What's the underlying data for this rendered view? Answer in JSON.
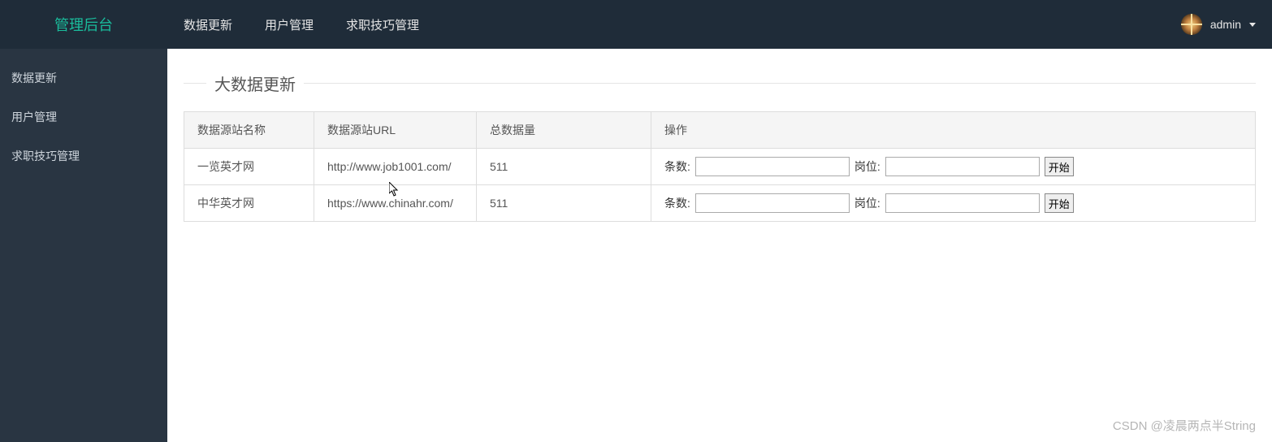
{
  "header": {
    "brand": "管理后台",
    "nav": [
      "数据更新",
      "用户管理",
      "求职技巧管理"
    ],
    "user": "admin"
  },
  "sidebar": {
    "items": [
      "数据更新",
      "用户管理",
      "求职技巧管理"
    ]
  },
  "main": {
    "title": "大数据更新",
    "columns": [
      "数据源站名称",
      "数据源站URL",
      "总数据量",
      "操作"
    ],
    "action_labels": {
      "count": "条数:",
      "position": "岗位:",
      "start": "开始"
    },
    "rows": [
      {
        "name": "一览英才网",
        "url": "http://www.job1001.com/",
        "total": "511"
      },
      {
        "name": "中华英才网",
        "url": "https://www.chinahr.com/",
        "total": "511"
      }
    ]
  },
  "watermark": "CSDN @凌晨两点半String"
}
